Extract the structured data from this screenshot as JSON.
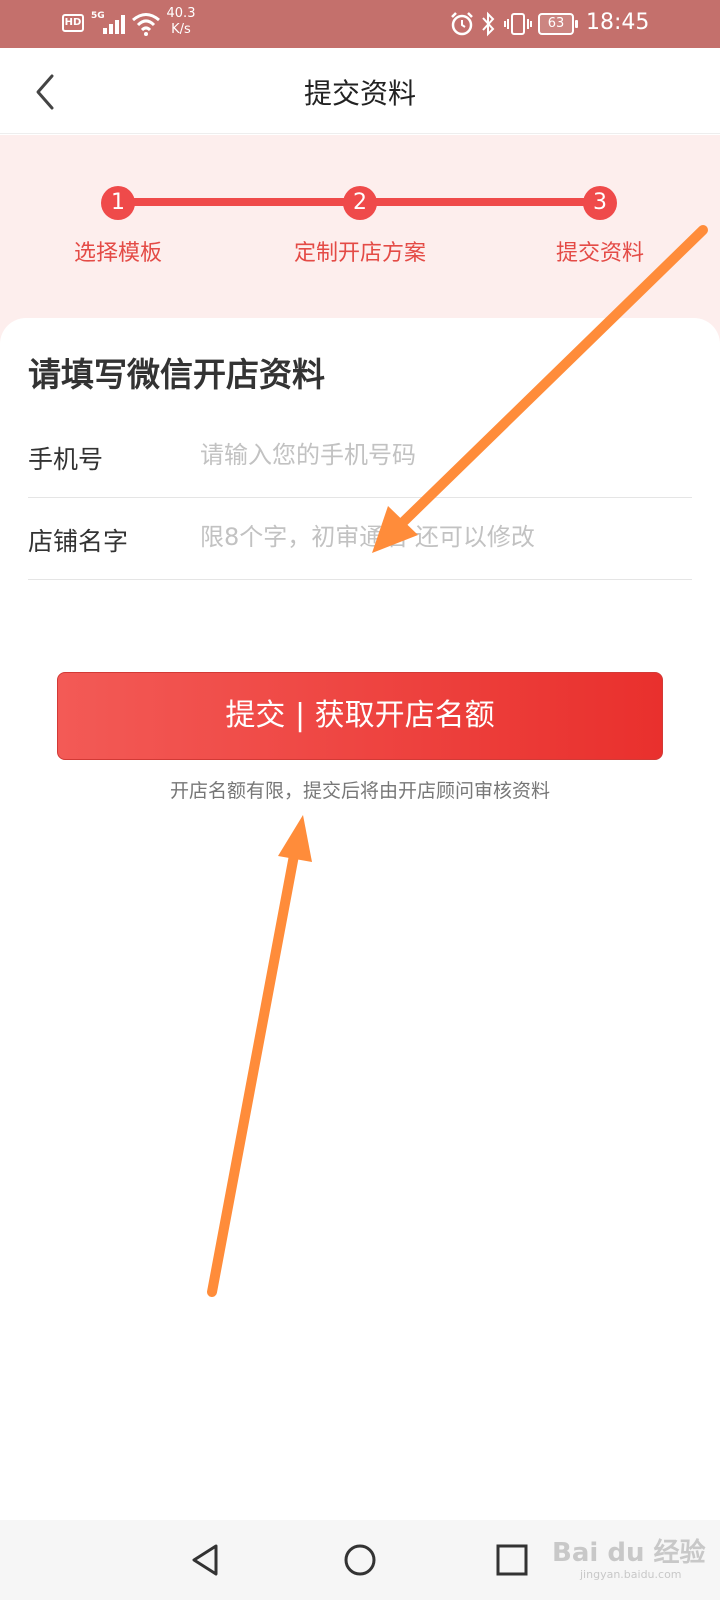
{
  "status_bar": {
    "hd_label": "HD",
    "network_label": "5G",
    "speed_value": "40.3",
    "speed_unit": "K/s",
    "battery_level": "63",
    "time": "18:45"
  },
  "header": {
    "title": "提交资料",
    "back_icon": "chevron-left-icon"
  },
  "steps": [
    {
      "number": "1",
      "label": "选择模板"
    },
    {
      "number": "2",
      "label": "定制开店方案"
    },
    {
      "number": "3",
      "label": "提交资料"
    }
  ],
  "form": {
    "title": "请填写微信开店资料",
    "phone": {
      "label": "手机号",
      "placeholder": "请输入您的手机号码",
      "value": ""
    },
    "store_name": {
      "label": "店铺名字",
      "placeholder": "限8个字，初审通后 还可以修改",
      "value": ""
    },
    "submit_label": "提交 | 获取开店名额",
    "hint": "开店名额有限，提交后将由开店顾问审核资料"
  },
  "colors": {
    "status_bar": "#c4706c",
    "accent": "#ef4a4a",
    "steps_background": "#fdeeed",
    "annotation_arrow": "#ff8c3a"
  },
  "watermark": {
    "brand": "Bai du 经验",
    "url": "jingyan.baidu.com"
  },
  "system_nav": [
    "back-triangle-icon",
    "home-circle-icon",
    "recent-square-icon"
  ]
}
